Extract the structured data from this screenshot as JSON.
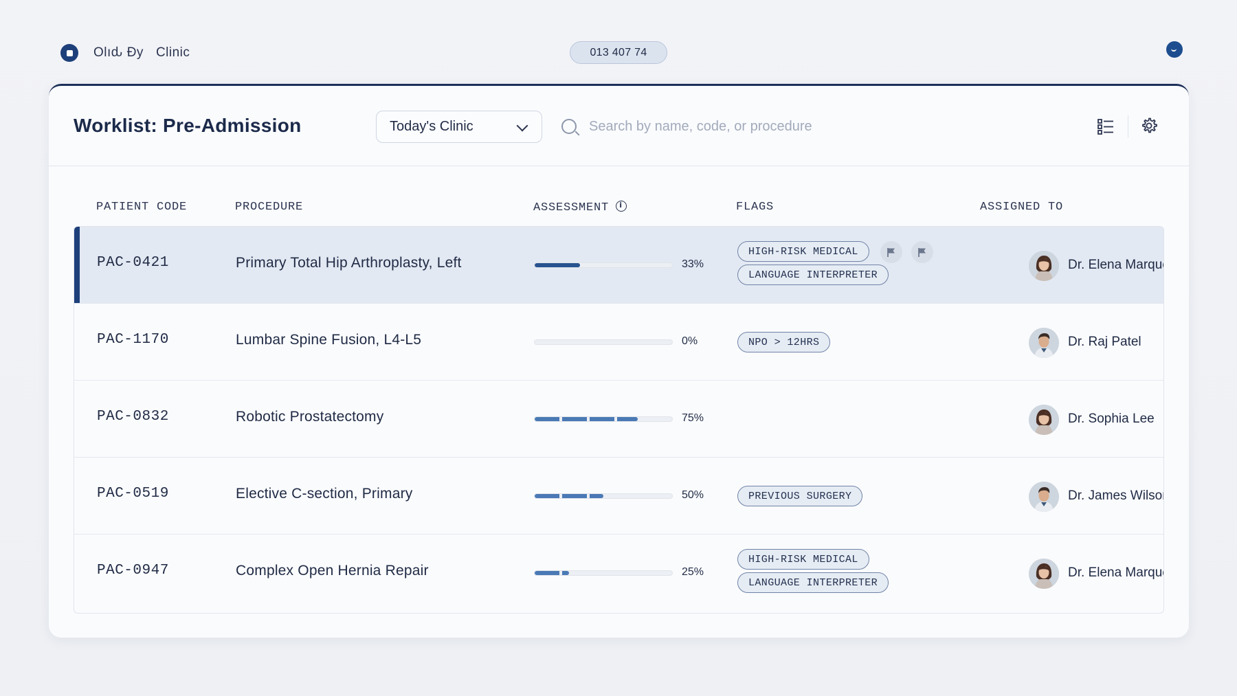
{
  "topbar": {
    "brand_name": "Olıԃ Ɖy",
    "brand_suffix": "Clinic",
    "phone": "013 407 74"
  },
  "header": {
    "title": "Worklist: Pre-Admission",
    "filter_selected": "Today's Clinic",
    "search_placeholder": "Search by name, code, or procedure"
  },
  "table": {
    "columns": [
      "PATIENT CODE",
      "PROCEDURE",
      "ASSESSMENT",
      "FLAGS",
      "ASSIGNED TO"
    ],
    "rows": [
      {
        "code": "PAC-0421",
        "procedure": "Primary Total Hip Arthroplasty, Left",
        "assessment_pct": 33,
        "assessment_label": "33%",
        "flags": [
          "HIGH-RISK MEDICAL",
          "LANGUAGE INTERPRETER"
        ],
        "assigned": "Dr. Elena Marquez",
        "avatar": "female"
      },
      {
        "code": "PAC-1170",
        "procedure": "Lumbar Spine Fusion, L4-L5",
        "assessment_pct": 0,
        "assessment_label": "0%",
        "flags": [
          "NPO > 12HRS"
        ],
        "assigned": "Dr. Raj Patel",
        "avatar": "male"
      },
      {
        "code": "PAC-0832",
        "procedure": "Robotic Prostatectomy",
        "assessment_pct": 75,
        "assessment_label": "75%",
        "flags": [],
        "assigned": "Dr. Sophia Lee",
        "avatar": "female"
      },
      {
        "code": "PAC-0519",
        "procedure": "Elective C-section, Primary",
        "assessment_pct": 50,
        "assessment_label": "50%",
        "flags": [
          "PREVIOUS SURGERY"
        ],
        "assigned": "Dr. James Wilson",
        "avatar": "male"
      },
      {
        "code": "PAC-0947",
        "procedure": "Complex Open Hernia Repair",
        "assessment_pct": 25,
        "assessment_label": "25%",
        "flags": [
          "HIGH-RISK MEDICAL",
          "LANGUAGE INTERPRETER"
        ],
        "assigned": "Dr. Elena Marquez",
        "avatar": "female"
      }
    ]
  },
  "selected_row_index": 0,
  "icons": {
    "brand": "brand-logo-icon",
    "profile": "profile-icon",
    "filter_dropdown": "chevron-down-icon",
    "search": "search-icon",
    "view_toggle": "list-view-icon",
    "settings": "gear-icon",
    "assessment_info": "info-icon",
    "row_flag": "flag-icon"
  },
  "colors": {
    "brand": "#1d3f7a",
    "progress": "#4a79b5",
    "selected_row": "#e3e9f3",
    "chip_border": "#6f83a6"
  }
}
